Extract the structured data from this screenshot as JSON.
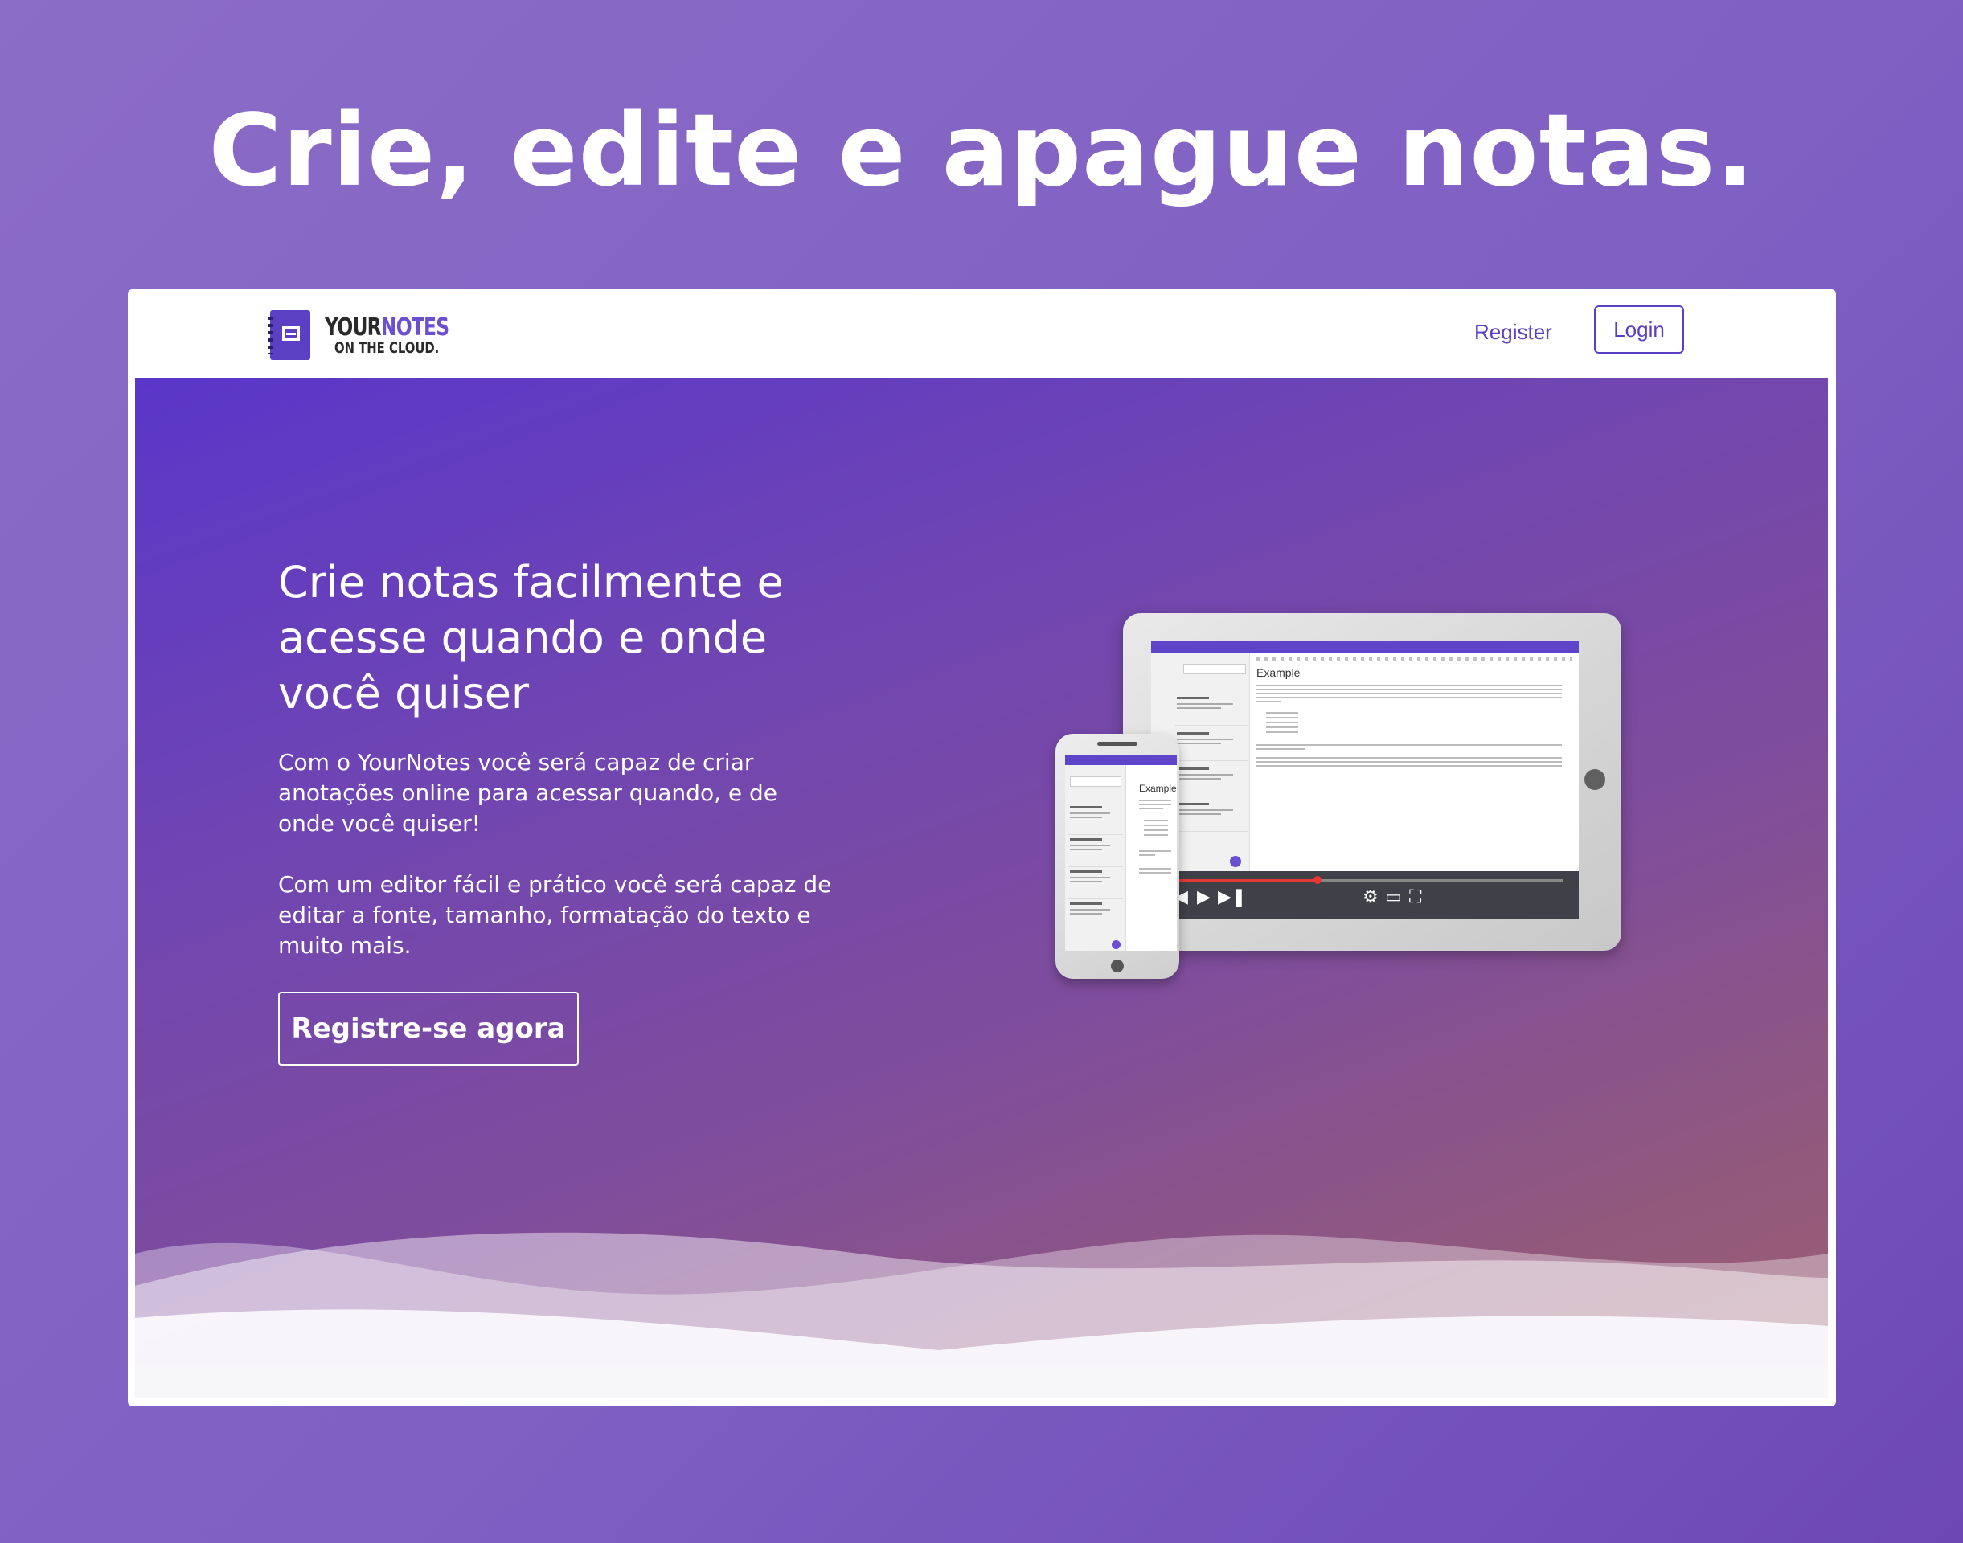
{
  "headline": "Crie, edite e apague notas.",
  "navbar": {
    "logo_your": "YOUR",
    "logo_notes": "NOTES",
    "logo_tagline": "ON THE CLOUD.",
    "register_label": "Register",
    "login_label": "Login"
  },
  "hero": {
    "title": "Crie notas facilmente e acesse quando e onde você quiser",
    "paragraph1": "Com o YourNotes você será capaz de criar anotações online para acessar quando, e de onde você quiser!",
    "paragraph2": "Com um editor fácil e prático você será capaz de editar a fonte, tamanho, formatação do texto e muito mais.",
    "cta_label": "Registre-se agora"
  },
  "mockup": {
    "editor_heading": "Example",
    "video_progress": 0.36
  },
  "colors": {
    "accent": "#5a3fc0",
    "page_background": "#8467c4",
    "hero_gradient_start": "#5a36c9",
    "hero_gradient_end": "#9d5f72",
    "video_progress": "#e53935"
  },
  "icons": {
    "logo": "notebook-icon",
    "video_play": "play-icon",
    "video_next": "skip-next-icon",
    "video_settings": "gear-icon",
    "video_theater": "theater-mode-icon",
    "video_fullscreen": "fullscreen-icon"
  }
}
